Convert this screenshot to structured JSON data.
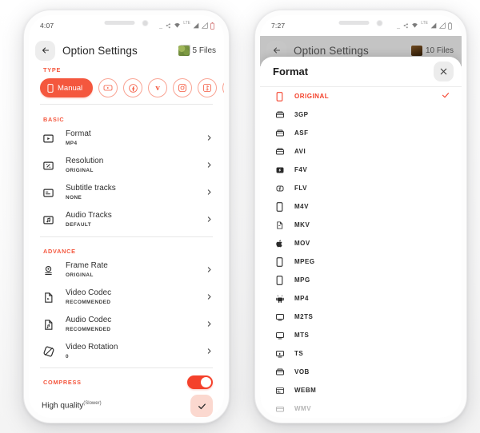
{
  "left_phone": {
    "status": {
      "time": "4:07",
      "network": "LTE"
    },
    "appbar": {
      "title": "Option Settings",
      "files_count": "5 Files",
      "back_icon": "arrow-left-icon"
    },
    "type_section": {
      "label": "TYPE",
      "chips": [
        {
          "label": "Manual",
          "icon": "phone-icon",
          "selected": true
        },
        {
          "label": "",
          "icon": "youtube-icon",
          "selected": false
        },
        {
          "label": "",
          "icon": "facebook-icon",
          "selected": false
        },
        {
          "label": "",
          "icon": "vimeo-icon",
          "selected": false
        },
        {
          "label": "",
          "icon": "instagram-icon",
          "selected": false
        },
        {
          "label": "",
          "icon": "tiktok-icon",
          "selected": false
        },
        {
          "label": "",
          "icon": "heart-icon",
          "selected": false
        }
      ]
    },
    "basic": {
      "label": "BASIC",
      "items": [
        {
          "title": "Format",
          "value": "MP4",
          "icon": "video-file-icon"
        },
        {
          "title": "Resolution",
          "value": "ORIGINAL",
          "icon": "resize-icon"
        },
        {
          "title": "Subtitle tracks",
          "value": "NONE",
          "icon": "subtitle-icon"
        },
        {
          "title": "Audio Tracks",
          "value": "DEFAULT",
          "icon": "audio-track-icon"
        }
      ]
    },
    "advance": {
      "label": "ADVANCE",
      "items": [
        {
          "title": "Frame Rate",
          "value": "ORIGINAL",
          "icon": "framerate-icon"
        },
        {
          "title": "Video Codec",
          "value": "RECOMMENDED",
          "icon": "video-codec-icon"
        },
        {
          "title": "Audio Codec",
          "value": "RECOMMENDED",
          "icon": "audio-codec-icon"
        },
        {
          "title": "Video Rotation",
          "value": "0",
          "icon": "rotate-icon"
        }
      ]
    },
    "compress": {
      "label": "COMPRESS",
      "toggle_on": true,
      "quality_label": "High quality",
      "quality_sup": "(Slower)",
      "quality_checked": true
    }
  },
  "right_phone": {
    "status": {
      "time": "7:27",
      "network": "LTE"
    },
    "appbar": {
      "title": "Option Settings",
      "files_count": "10 Files",
      "back_icon": "arrow-left-icon"
    },
    "sheet": {
      "title": "Format",
      "close_icon": "close-icon",
      "items": [
        {
          "label": "ORIGINAL",
          "icon": "phone-icon",
          "selected": true
        },
        {
          "label": "3GP",
          "icon": "film-icon",
          "selected": false
        },
        {
          "label": "ASF",
          "icon": "film-icon",
          "selected": false
        },
        {
          "label": "AVI",
          "icon": "film-icon",
          "selected": false
        },
        {
          "label": "F4V",
          "icon": "flash-icon",
          "selected": false
        },
        {
          "label": "FLV",
          "icon": "flash-icon",
          "selected": false
        },
        {
          "label": "M4V",
          "icon": "phone-icon",
          "selected": false
        },
        {
          "label": "MKV",
          "icon": "doc-icon",
          "selected": false
        },
        {
          "label": "MOV",
          "icon": "apple-icon",
          "selected": false
        },
        {
          "label": "MPEG",
          "icon": "phone-icon",
          "selected": false
        },
        {
          "label": "MPG",
          "icon": "phone-icon",
          "selected": false
        },
        {
          "label": "MP4",
          "icon": "android-icon",
          "selected": false
        },
        {
          "label": "M2TS",
          "icon": "tv-icon",
          "selected": false
        },
        {
          "label": "MTS",
          "icon": "tv-icon",
          "selected": false
        },
        {
          "label": "TS",
          "icon": "tv-icon",
          "selected": false
        },
        {
          "label": "VOB",
          "icon": "film-icon",
          "selected": false
        },
        {
          "label": "WEBM",
          "icon": "web-icon",
          "selected": false
        },
        {
          "label": "WMV",
          "icon": "film-icon",
          "selected": false
        }
      ]
    }
  },
  "colors": {
    "accent": "#F4573E",
    "accent_strong": "#F4412B",
    "check_bg": "#FBD8CF"
  }
}
